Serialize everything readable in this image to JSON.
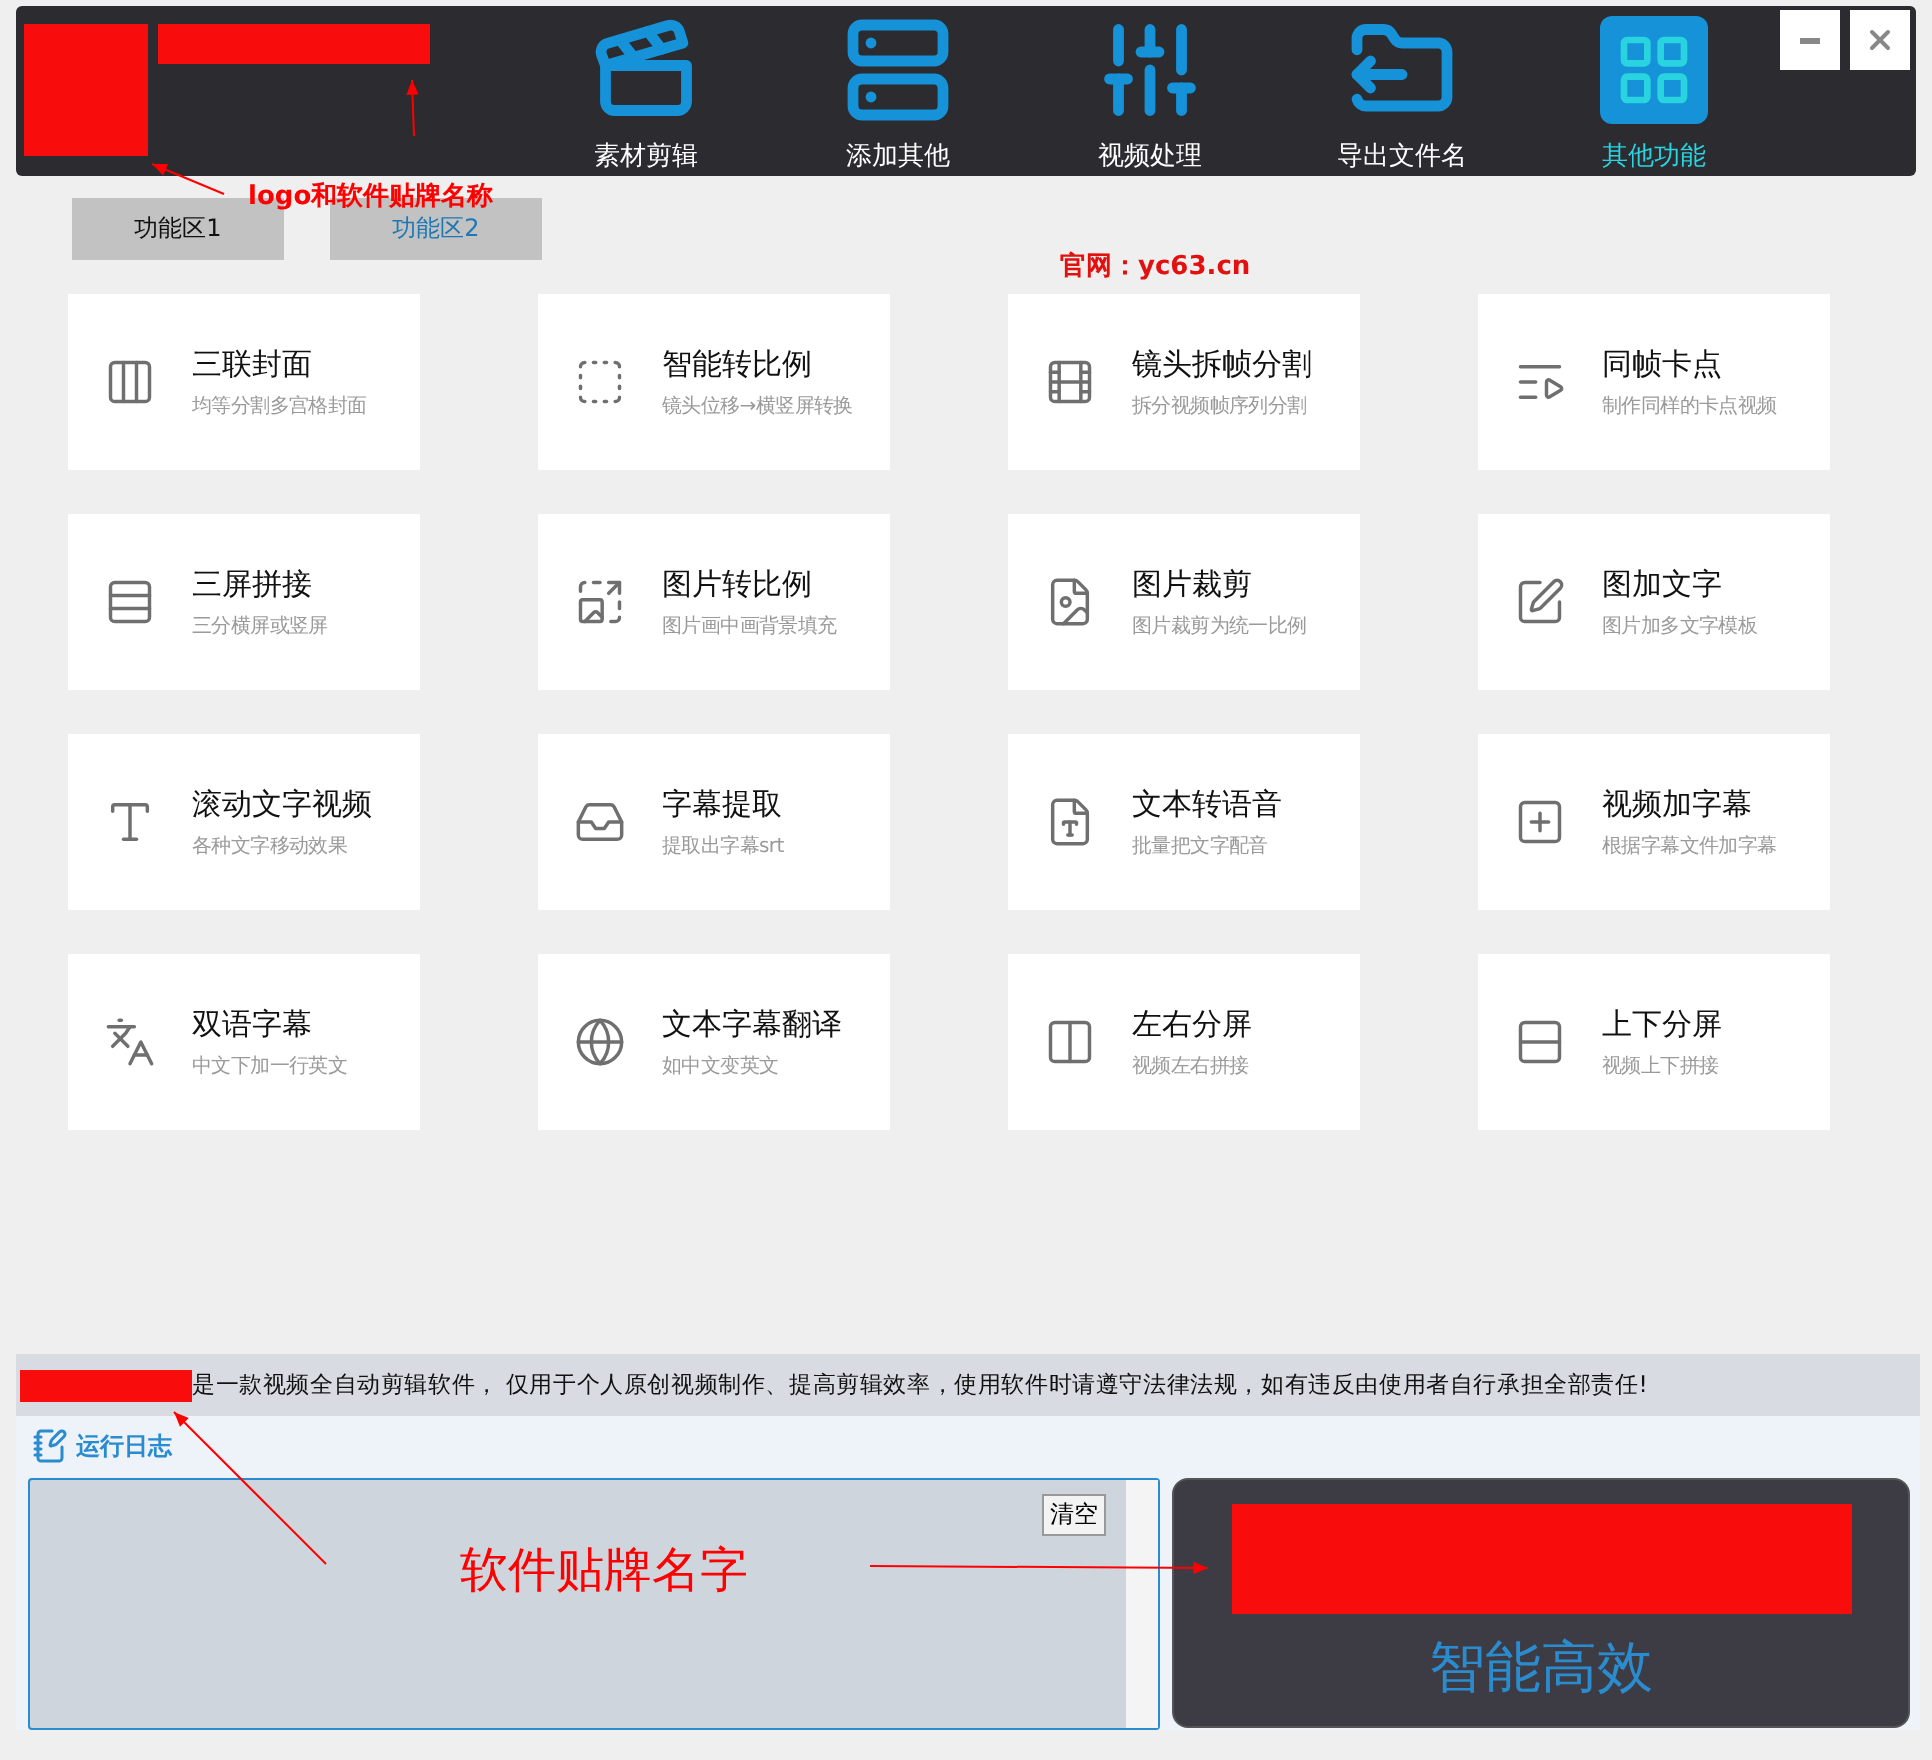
{
  "nav": [
    {
      "label": "素材剪辑",
      "selected": false
    },
    {
      "label": "添加其他",
      "selected": false
    },
    {
      "label": "视频处理",
      "selected": false
    },
    {
      "label": "导出文件名",
      "selected": false
    },
    {
      "label": "其他功能",
      "selected": true
    }
  ],
  "tabs": [
    {
      "label": "功能区1",
      "selected": true
    },
    {
      "label": "功能区2",
      "selected": false
    }
  ],
  "website": "官网：yc63.cn",
  "features": [
    {
      "title": "三联封面",
      "subtitle": "均等分割多宫格封面"
    },
    {
      "title": "智能转比例",
      "subtitle": "镜头位移→横竖屏转换"
    },
    {
      "title": "镜头拆帧分割",
      "subtitle": "拆分视频帧序列分割"
    },
    {
      "title": "同帧卡点",
      "subtitle": "制作同样的卡点视频"
    },
    {
      "title": "三屏拼接",
      "subtitle": "三分横屏或竖屏"
    },
    {
      "title": "图片转比例",
      "subtitle": "图片画中画背景填充"
    },
    {
      "title": "图片裁剪",
      "subtitle": "图片裁剪为统一比例"
    },
    {
      "title": "图加文字",
      "subtitle": "图片加多文字模板"
    },
    {
      "title": "滚动文字视频",
      "subtitle": "各种文字移动效果"
    },
    {
      "title": "字幕提取",
      "subtitle": "提取出字幕srt"
    },
    {
      "title": "文本转语音",
      "subtitle": "批量把文字配音"
    },
    {
      "title": "视频加字幕",
      "subtitle": "根据字幕文件加字幕"
    },
    {
      "title": "双语字幕",
      "subtitle": "中文下加一行英文"
    },
    {
      "title": "文本字幕翻译",
      "subtitle": "如中文变英文"
    },
    {
      "title": "左右分屏",
      "subtitle": "视频左右拼接"
    },
    {
      "title": "上下分屏",
      "subtitle": "视频上下拼接"
    }
  ],
  "notice": "是一款视频全自动剪辑软件， 仅用于个人原创视频制作、提高剪辑效率，使用软件时请遵守法律法规，如有违反由使用者自行承担全部责任!",
  "log": {
    "title": "运行日志",
    "clear_button": "清空"
  },
  "promo": "智能高效",
  "annotations": [
    {
      "text": "logo和软件贴牌名称"
    },
    {
      "text": "软件贴牌名字"
    }
  ]
}
